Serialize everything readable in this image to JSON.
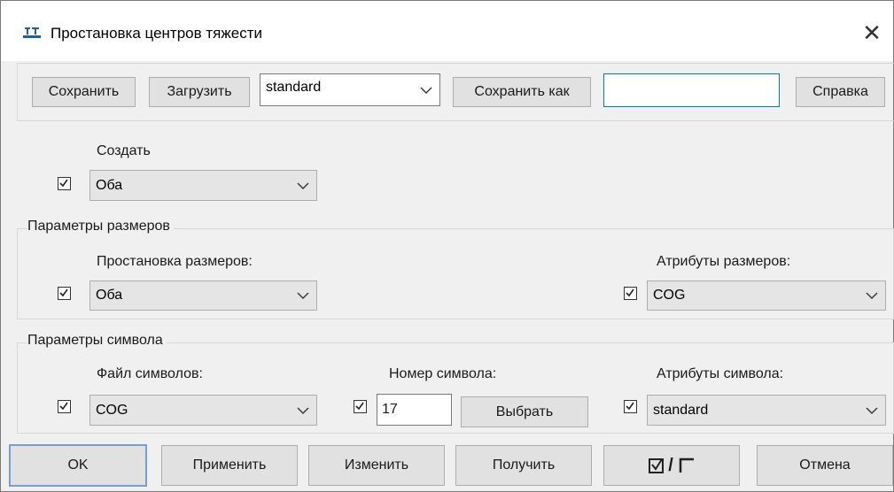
{
  "window": {
    "title": "Простановка центров тяжести",
    "close_glyph": "✕"
  },
  "toolbar": {
    "save_label": "Сохранить",
    "load_label": "Загрузить",
    "preset_value": "standard",
    "save_as_label": "Сохранить как",
    "save_as_name": "",
    "help_label": "Справка"
  },
  "create": {
    "label": "Создать",
    "checked": true,
    "value": "Оба"
  },
  "dimensions_group": {
    "title": "Параметры размеров",
    "placement_label": "Простановка размеров:",
    "placement_checked": true,
    "placement_value": "Оба",
    "attributes_label": "Атрибуты размеров:",
    "attributes_checked": true,
    "attributes_value": "COG"
  },
  "symbol_group": {
    "title": "Параметры символа",
    "file_label": "Файл символов:",
    "file_checked": true,
    "file_value": "COG",
    "number_label": "Номер символа:",
    "number_checked": true,
    "number_value": "17",
    "select_label": "Выбрать",
    "attributes_label": "Атрибуты символа:",
    "attributes_checked": true,
    "attributes_value": "standard"
  },
  "footer": {
    "ok_label": "OK",
    "apply_label": "Применить",
    "modify_label": "Изменить",
    "get_label": "Получить",
    "toggle_all_label": "/",
    "cancel_label": "Отмена"
  },
  "icons": [
    "app-icon",
    "close-icon",
    "chevron-down-icon",
    "checkbox-checked-icon",
    "checkbox-checked-glyph-icon",
    "checkbox-empty-glyph-icon"
  ],
  "colors": {
    "dialog_bg": "#f0f0f0",
    "button_bg": "#e1e1e1",
    "focus_border": "#0078d7",
    "app_icon": "#1f5fa8"
  }
}
